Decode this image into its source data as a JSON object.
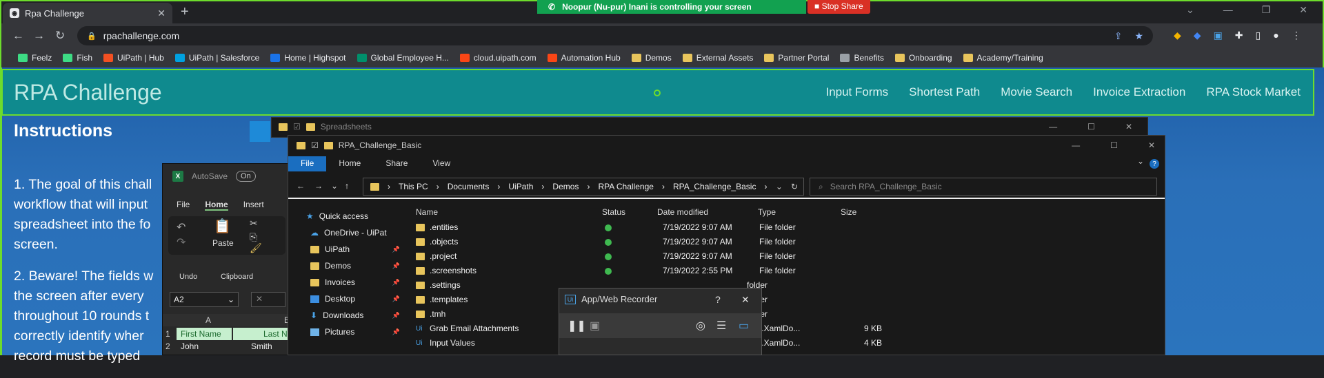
{
  "browser": {
    "tab_title": "Rpa Challenge",
    "url": "rpachallenge.com",
    "new_tab": "+",
    "share_message": "Noopur (Nu-pur)  Inani is controlling your screen",
    "stop_share": "Stop Share",
    "bookmarks": [
      {
        "label": "Feelz",
        "color": "#3ddc84"
      },
      {
        "label": "Fish",
        "color": "#3ddc84"
      },
      {
        "label": "UiPath | Hub",
        "color": "#f25022"
      },
      {
        "label": "UiPath | Salesforce",
        "color": "#00a1e0"
      },
      {
        "label": "Home | Highspot",
        "color": "#1a73e8"
      },
      {
        "label": "Global Employee H...",
        "color": "#008f6b"
      },
      {
        "label": "cloud.uipath.com",
        "color": "#fa4616"
      },
      {
        "label": "Automation Hub",
        "color": "#fa4616"
      },
      {
        "label": "Demos",
        "color": "#e8c55c"
      },
      {
        "label": "External Assets",
        "color": "#e8c55c"
      },
      {
        "label": "Partner Portal",
        "color": "#e8c55c"
      },
      {
        "label": "Benefits",
        "color": "#9aa0a6"
      },
      {
        "label": "Onboarding",
        "color": "#e8c55c"
      },
      {
        "label": "Academy/Training",
        "color": "#e8c55c"
      }
    ]
  },
  "rpa": {
    "title": "RPA Challenge",
    "nav": [
      "Input Forms",
      "Shortest Path",
      "Movie Search",
      "Invoice Extraction",
      "RPA Stock Market"
    ],
    "instructions_heading": "Instructions",
    "lines1": [
      "1. The goal of this chall",
      "workflow that will input",
      "spreadsheet into the fo",
      "screen."
    ],
    "lines2": [
      "2. Beware! The fields w",
      "the screen after every",
      "throughout 10 rounds t",
      "correctly identify wher",
      "record must be typed"
    ]
  },
  "excel": {
    "autosave": "AutoSave",
    "autosave_state": "On",
    "tabs": [
      "File",
      "Home",
      "Insert"
    ],
    "undo_label": "Undo",
    "paste_label": "Paste",
    "clipboard_label": "Clipboard",
    "namebox": "A2",
    "col_a": "A",
    "col_b": "B",
    "row1_num": "1",
    "row2_num": "2",
    "header_first": "First Name",
    "header_last": "Last N",
    "row2_first": "John",
    "row2_last": "Smith"
  },
  "explorer_back": {
    "title": "Spreadsheets"
  },
  "explorer": {
    "title": "RPA_Challenge_Basic",
    "ribbon": [
      "File",
      "Home",
      "Share",
      "View"
    ],
    "breadcrumb": [
      "This PC",
      "Documents",
      "UiPath",
      "Demos",
      "RPA Challenge",
      "RPA_Challenge_Basic"
    ],
    "search_placeholder": "Search RPA_Challenge_Basic",
    "nav": [
      {
        "label": "Quick access",
        "pinned": false
      },
      {
        "label": "OneDrive - UiPat",
        "pinned": false
      },
      {
        "label": "UiPath",
        "pinned": true
      },
      {
        "label": "Demos",
        "pinned": true
      },
      {
        "label": "Invoices",
        "pinned": true
      },
      {
        "label": "Desktop",
        "pinned": true
      },
      {
        "label": "Downloads",
        "pinned": true
      },
      {
        "label": "Pictures",
        "pinned": true
      }
    ],
    "columns": [
      "Name",
      "Status",
      "Date modified",
      "Type",
      "Size"
    ],
    "files": [
      {
        "name": ".entities",
        "status": true,
        "date": "7/19/2022 9:07 AM",
        "type": "File folder",
        "size": ""
      },
      {
        "name": ".objects",
        "status": true,
        "date": "7/19/2022 9:07 AM",
        "type": "File folder",
        "size": ""
      },
      {
        "name": ".project",
        "status": true,
        "date": "7/19/2022 9:07 AM",
        "type": "File folder",
        "size": ""
      },
      {
        "name": ".screenshots",
        "status": true,
        "date": "7/19/2022 2:55 PM",
        "type": "File folder",
        "size": ""
      },
      {
        "name": ".settings",
        "status": false,
        "date": "",
        "type": "folder",
        "size": ""
      },
      {
        "name": ".templates",
        "status": false,
        "date": "",
        "type": "folder",
        "size": ""
      },
      {
        "name": ".tmh",
        "status": false,
        "date": "",
        "type": "folder",
        "size": ""
      },
      {
        "name": "Grab Email Attachments",
        "status": false,
        "date": "",
        "type": "ows.XamlDo...",
        "size": "9 KB"
      },
      {
        "name": "Input Values",
        "status": false,
        "date": "",
        "type": "ows.XamlDo...",
        "size": "4 KB"
      }
    ]
  },
  "recorder": {
    "title": "App/Web Recorder",
    "help": "?",
    "close": "✕"
  }
}
